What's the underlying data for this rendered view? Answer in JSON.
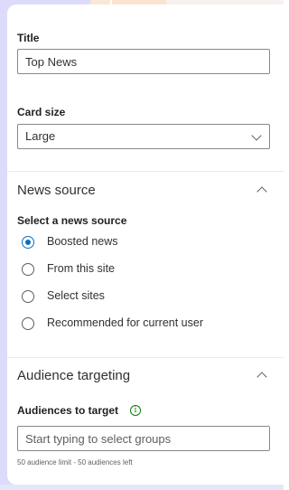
{
  "title_field": {
    "label": "Title",
    "value": "Top News"
  },
  "card_size": {
    "label": "Card size",
    "selected": "Large"
  },
  "news_source": {
    "title": "News source",
    "subtitle": "Select a news source",
    "options": [
      {
        "label": "Boosted news",
        "checked": true
      },
      {
        "label": "From this site",
        "checked": false
      },
      {
        "label": "Select sites",
        "checked": false
      },
      {
        "label": "Recommended for current user",
        "checked": false
      }
    ]
  },
  "audience": {
    "title": "Audience targeting",
    "label": "Audiences to target",
    "info_icon_glyph": "i",
    "placeholder": "Start typing to select groups",
    "hint": "50 audience limit - 50 audiences left"
  },
  "colors": {
    "accent": "#0f6cbd",
    "info": "#107c10"
  }
}
